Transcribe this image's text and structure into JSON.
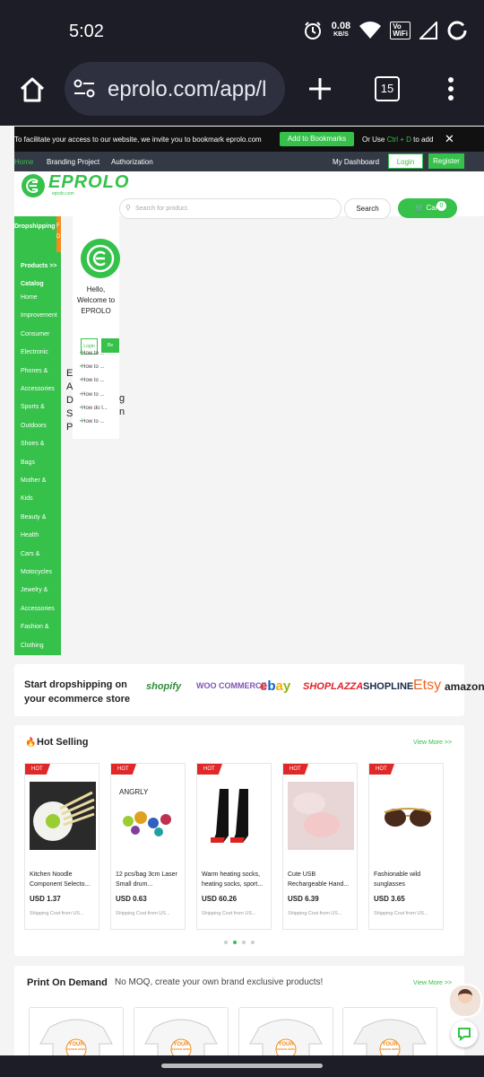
{
  "status_bar": {
    "time": "5:02",
    "speed_value": "0.08",
    "speed_unit": "KB/S",
    "vowifi_top": "Vo",
    "vowifi_bottom": "WiFi"
  },
  "browser": {
    "url": "eprolo.com/app/l",
    "tab_count": "15"
  },
  "notice": {
    "text": "To facilitate your access to our website, we invite you to bookmark eprolo.com",
    "bookmark_label": "Add to Bookmarks",
    "or_use": "Or Use",
    "shortcut": "Ctrl + D",
    "to_add": "to add"
  },
  "topnav": {
    "home": "Home",
    "branding": "Branding Project",
    "authorization": "Authorization",
    "dashboard": "My Dashboard",
    "login": "Login",
    "register": "Register"
  },
  "brand": {
    "logo_text": "EPROLO",
    "logo_sub": "eprolo.com",
    "accent": "#35c14a"
  },
  "search": {
    "placeholder": "Search for product.",
    "button": "Search",
    "cart": "Cart",
    "cart_count": "0"
  },
  "category_panel": {
    "tab_dropshipping": "Dropshipping",
    "tab_second_top": "F",
    "tab_second_bottom": "D",
    "products_catalog": "Products >> Catalog",
    "items": [
      "Home",
      "Improvement",
      "Consumer",
      "Electronic",
      "Phones &",
      "Accessories",
      "Sports &",
      "Outdoors",
      "Shoes &",
      "Bags",
      "Mother &",
      "Kids",
      "Beauty &",
      "Health",
      "Cars &",
      "Motocycles",
      "Jewelry &",
      "Accessories",
      "Fashion &",
      "Clothing"
    ]
  },
  "welcome_panel": {
    "greeting": "Hello, Welcome to EPROLO",
    "login": "Login",
    "register": "Re",
    "links": [
      "How to ...",
      "How to ...",
      "How to ...",
      "How to ...",
      "How do I...",
      "How to ..."
    ],
    "overflow_left": "EADSP",
    "overflow_right": "gn"
  },
  "platforms": {
    "heading": "Start dropshipping on your ecommerce store",
    "logos": [
      "shopify",
      "WOO COMMERCE",
      "ebay",
      "SHOPLAZZA",
      "SHOPLINE",
      "Etsy",
      "amazon"
    ]
  },
  "hot_selling": {
    "title": "Hot Selling",
    "view_more": "View More >>",
    "badge": "HOT",
    "products": [
      {
        "name": "Kitchen Noodle Component Selecto...",
        "price": "USD 1.37",
        "shipping": "Shipping Cost from US..."
      },
      {
        "name": "12 pcs/bag 3cm Laser Small drum...",
        "price": "USD 0.63",
        "shipping": "Shipping Cost from US...",
        "image_text": "ANGRLY"
      },
      {
        "name": "Warm heating socks, heating socks, sport...",
        "price": "USD 60.26",
        "shipping": "Shipping Cost from US..."
      },
      {
        "name": "Cute USB Rechargeable Hand...",
        "price": "USD 6.39",
        "shipping": "Shipping Cost from US..."
      },
      {
        "name": "Fashionable wild sunglasses",
        "price": "USD 3.65",
        "shipping": "Shipping Cost from US..."
      }
    ],
    "active_dot": 1
  },
  "print_on_demand": {
    "title": "Print On Demand",
    "subtitle": "No MOQ, create your own brand exclusive products!",
    "view_more": "View More >>",
    "design_label_top": "YOUR",
    "design_label_bottom": "DESIGN HERE"
  }
}
